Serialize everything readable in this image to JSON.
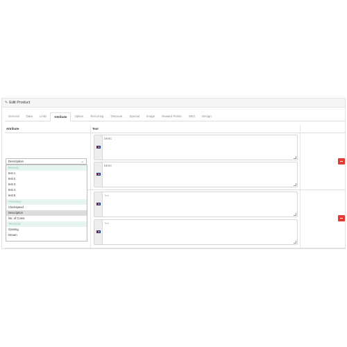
{
  "panel": {
    "title": "Edit Product"
  },
  "tabs": [
    "General",
    "Data",
    "Links",
    "Attribute",
    "Option",
    "Recurring",
    "Discount",
    "Special",
    "Image",
    "Reward Points",
    "SEO",
    "Design"
  ],
  "active_tab": "Attribute",
  "table": {
    "col_attribute": "Attribute",
    "col_text": "Text",
    "col_action": ""
  },
  "rows": [
    {
      "texts": [
        {
          "value": "DESC",
          "placeholder": ""
        },
        {
          "value": "DESC",
          "placeholder": ""
        }
      ]
    },
    {
      "texts": [
        {
          "value": "",
          "placeholder": "Text"
        },
        {
          "value": "",
          "placeholder": "Text"
        }
      ]
    }
  ],
  "select": {
    "value": "Description"
  },
  "options": [
    {
      "label": "Memory",
      "group": true
    },
    {
      "label": "test 1"
    },
    {
      "label": "test 2"
    },
    {
      "label": "test 3"
    },
    {
      "label": "test 4"
    },
    {
      "label": "test 5"
    },
    {
      "label": "Processor",
      "group": true
    },
    {
      "label": "Clockspeed"
    },
    {
      "label": "Description",
      "selected": true
    },
    {
      "label": "No. of Cores"
    },
    {
      "label": "Technical",
      "group": true
    },
    {
      "label": "Gaming"
    },
    {
      "label": "Dream"
    }
  ],
  "colors": {
    "danger": "#e53935",
    "accent_group": "#8fbfa8"
  }
}
